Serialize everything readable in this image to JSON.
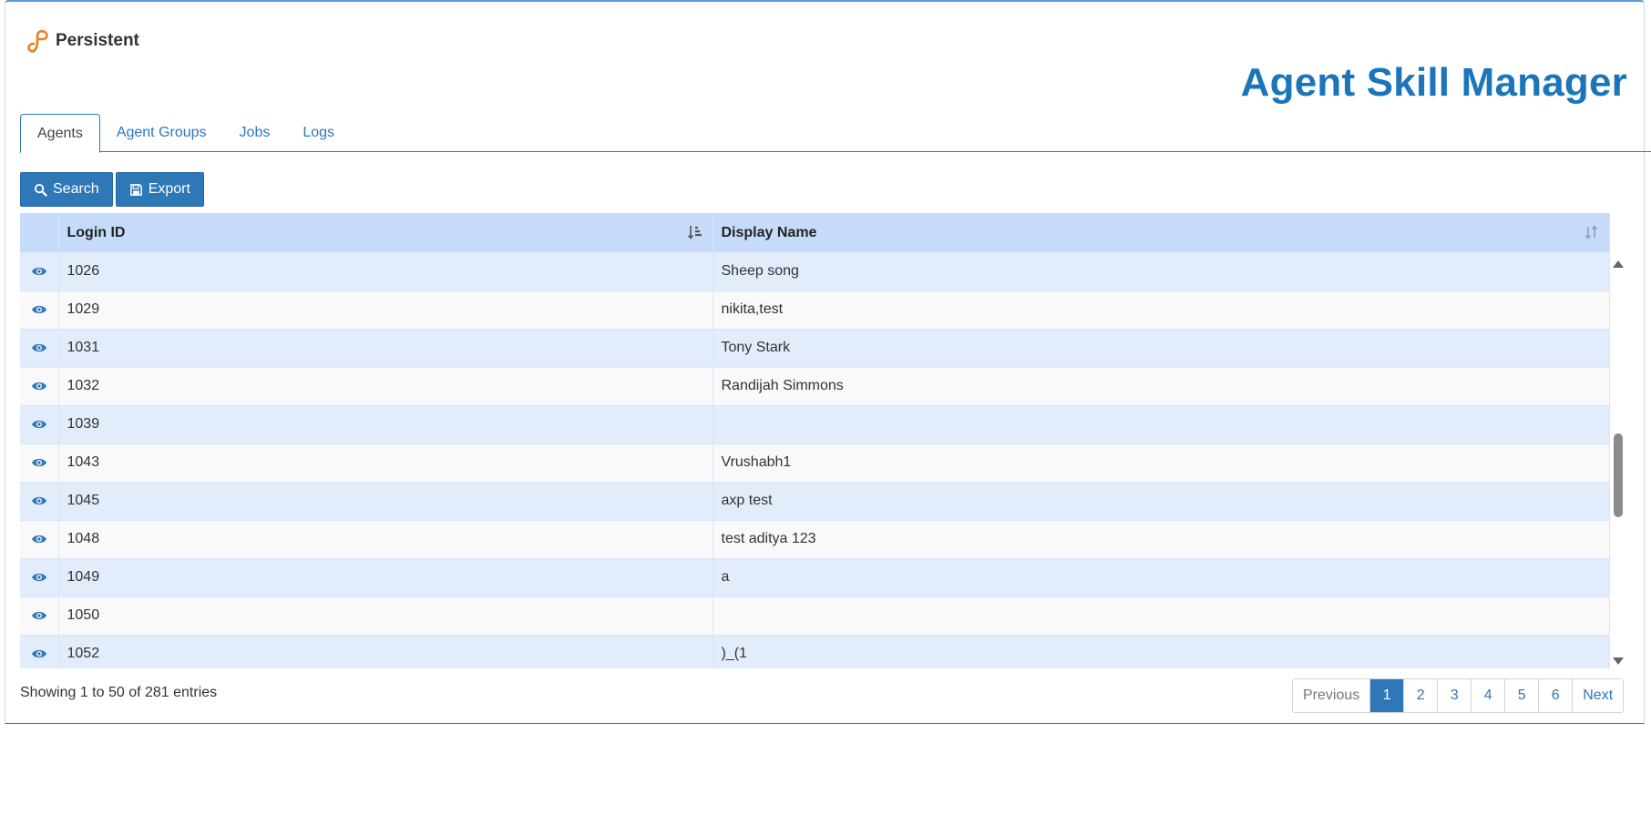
{
  "app": {
    "logo_text": "Persistent",
    "title": "Agent Skill Manager"
  },
  "tabs": [
    {
      "label": "Agents",
      "active": true
    },
    {
      "label": "Agent Groups",
      "active": false
    },
    {
      "label": "Jobs",
      "active": false
    },
    {
      "label": "Logs",
      "active": false
    }
  ],
  "toolbar": {
    "search_label": "Search",
    "export_label": "Export"
  },
  "table": {
    "columns": [
      "Login ID",
      "Display Name"
    ],
    "rows": [
      {
        "login_id": "1026",
        "display_name": "Sheep song"
      },
      {
        "login_id": "1029",
        "display_name": "nikita,test"
      },
      {
        "login_id": "1031",
        "display_name": "Tony Stark"
      },
      {
        "login_id": "1032",
        "display_name": "Randijah Simmons"
      },
      {
        "login_id": "1039",
        "display_name": ""
      },
      {
        "login_id": "1043",
        "display_name": "Vrushabh1"
      },
      {
        "login_id": "1045",
        "display_name": "axp test"
      },
      {
        "login_id": "1048",
        "display_name": "test aditya 123"
      },
      {
        "login_id": "1049",
        "display_name": "a"
      },
      {
        "login_id": "1050",
        "display_name": ""
      },
      {
        "login_id": "1052",
        "display_name": ")_(1"
      },
      {
        "login_id": "",
        "display_name": ""
      }
    ]
  },
  "info_text": "Showing 1 to 50 of 281 entries",
  "pagination": {
    "previous": "Previous",
    "pages": [
      "1",
      "2",
      "3",
      "4",
      "5",
      "6"
    ],
    "active_page": "1",
    "next": "Next"
  },
  "colors": {
    "accent": "#2e78b7",
    "title": "#1a75bb",
    "header_bg": "#c6dbfa",
    "row_odd": "#e3ecfa",
    "logo": "#f07d1a"
  }
}
